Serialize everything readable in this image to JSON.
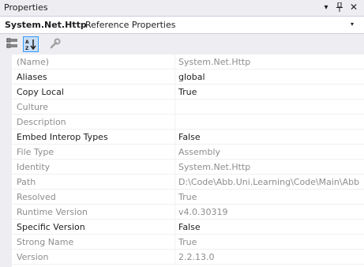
{
  "window": {
    "title": "Properties",
    "dropdown_glyph": "▾",
    "pin_glyph": "⊥",
    "close_glyph": "✕"
  },
  "object_selector": {
    "name": "System.Net.Http",
    "type": "Reference Properties",
    "dropdown_glyph": "▾"
  },
  "toolbar": {
    "buttons": [
      {
        "name": "categorized-icon",
        "active": false
      },
      {
        "name": "alphabetical-icon",
        "active": true
      },
      {
        "name": "property-pages-icon",
        "active": false
      }
    ]
  },
  "properties": [
    {
      "name": "(Name)",
      "value": "System.Net.Http",
      "readonly": true
    },
    {
      "name": "Aliases",
      "value": "global",
      "readonly": false
    },
    {
      "name": "Copy Local",
      "value": "True",
      "readonly": false
    },
    {
      "name": "Culture",
      "value": "",
      "readonly": true
    },
    {
      "name": "Description",
      "value": "",
      "readonly": true
    },
    {
      "name": "Embed Interop Types",
      "value": "False",
      "readonly": false
    },
    {
      "name": "File Type",
      "value": "Assembly",
      "readonly": true
    },
    {
      "name": "Identity",
      "value": "System.Net.Http",
      "readonly": true
    },
    {
      "name": "Path",
      "value": "D:\\Code\\Abb.Uni.Learning\\Code\\Main\\Abb",
      "readonly": true
    },
    {
      "name": "Resolved",
      "value": "True",
      "readonly": true
    },
    {
      "name": "Runtime Version",
      "value": "v4.0.30319",
      "readonly": true
    },
    {
      "name": "Specific Version",
      "value": "False",
      "readonly": false
    },
    {
      "name": "Strong Name",
      "value": "True",
      "readonly": true
    },
    {
      "name": "Version",
      "value": "2.2.13.0",
      "readonly": true
    }
  ],
  "colors": {
    "chrome": "#eeeef2",
    "readonly_text": "#8d8d8d",
    "editable_text": "#1e1e1e",
    "selected_button": "#c9def5",
    "selected_border": "#3399ff"
  }
}
